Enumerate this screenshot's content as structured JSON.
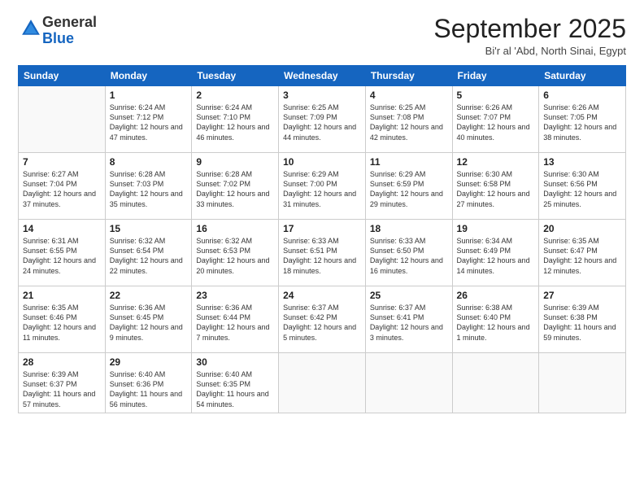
{
  "logo": {
    "general": "General",
    "blue": "Blue"
  },
  "header": {
    "month": "September 2025",
    "location": "Bi'r al 'Abd, North Sinai, Egypt"
  },
  "days_of_week": [
    "Sunday",
    "Monday",
    "Tuesday",
    "Wednesday",
    "Thursday",
    "Friday",
    "Saturday"
  ],
  "weeks": [
    [
      {
        "day": "",
        "empty": true
      },
      {
        "day": "1",
        "sunrise": "Sunrise: 6:24 AM",
        "sunset": "Sunset: 7:12 PM",
        "daylight": "Daylight: 12 hours and 47 minutes."
      },
      {
        "day": "2",
        "sunrise": "Sunrise: 6:24 AM",
        "sunset": "Sunset: 7:10 PM",
        "daylight": "Daylight: 12 hours and 46 minutes."
      },
      {
        "day": "3",
        "sunrise": "Sunrise: 6:25 AM",
        "sunset": "Sunset: 7:09 PM",
        "daylight": "Daylight: 12 hours and 44 minutes."
      },
      {
        "day": "4",
        "sunrise": "Sunrise: 6:25 AM",
        "sunset": "Sunset: 7:08 PM",
        "daylight": "Daylight: 12 hours and 42 minutes."
      },
      {
        "day": "5",
        "sunrise": "Sunrise: 6:26 AM",
        "sunset": "Sunset: 7:07 PM",
        "daylight": "Daylight: 12 hours and 40 minutes."
      },
      {
        "day": "6",
        "sunrise": "Sunrise: 6:26 AM",
        "sunset": "Sunset: 7:05 PM",
        "daylight": "Daylight: 12 hours and 38 minutes."
      }
    ],
    [
      {
        "day": "7",
        "sunrise": "Sunrise: 6:27 AM",
        "sunset": "Sunset: 7:04 PM",
        "daylight": "Daylight: 12 hours and 37 minutes."
      },
      {
        "day": "8",
        "sunrise": "Sunrise: 6:28 AM",
        "sunset": "Sunset: 7:03 PM",
        "daylight": "Daylight: 12 hours and 35 minutes."
      },
      {
        "day": "9",
        "sunrise": "Sunrise: 6:28 AM",
        "sunset": "Sunset: 7:02 PM",
        "daylight": "Daylight: 12 hours and 33 minutes."
      },
      {
        "day": "10",
        "sunrise": "Sunrise: 6:29 AM",
        "sunset": "Sunset: 7:00 PM",
        "daylight": "Daylight: 12 hours and 31 minutes."
      },
      {
        "day": "11",
        "sunrise": "Sunrise: 6:29 AM",
        "sunset": "Sunset: 6:59 PM",
        "daylight": "Daylight: 12 hours and 29 minutes."
      },
      {
        "day": "12",
        "sunrise": "Sunrise: 6:30 AM",
        "sunset": "Sunset: 6:58 PM",
        "daylight": "Daylight: 12 hours and 27 minutes."
      },
      {
        "day": "13",
        "sunrise": "Sunrise: 6:30 AM",
        "sunset": "Sunset: 6:56 PM",
        "daylight": "Daylight: 12 hours and 25 minutes."
      }
    ],
    [
      {
        "day": "14",
        "sunrise": "Sunrise: 6:31 AM",
        "sunset": "Sunset: 6:55 PM",
        "daylight": "Daylight: 12 hours and 24 minutes."
      },
      {
        "day": "15",
        "sunrise": "Sunrise: 6:32 AM",
        "sunset": "Sunset: 6:54 PM",
        "daylight": "Daylight: 12 hours and 22 minutes."
      },
      {
        "day": "16",
        "sunrise": "Sunrise: 6:32 AM",
        "sunset": "Sunset: 6:53 PM",
        "daylight": "Daylight: 12 hours and 20 minutes."
      },
      {
        "day": "17",
        "sunrise": "Sunrise: 6:33 AM",
        "sunset": "Sunset: 6:51 PM",
        "daylight": "Daylight: 12 hours and 18 minutes."
      },
      {
        "day": "18",
        "sunrise": "Sunrise: 6:33 AM",
        "sunset": "Sunset: 6:50 PM",
        "daylight": "Daylight: 12 hours and 16 minutes."
      },
      {
        "day": "19",
        "sunrise": "Sunrise: 6:34 AM",
        "sunset": "Sunset: 6:49 PM",
        "daylight": "Daylight: 12 hours and 14 minutes."
      },
      {
        "day": "20",
        "sunrise": "Sunrise: 6:35 AM",
        "sunset": "Sunset: 6:47 PM",
        "daylight": "Daylight: 12 hours and 12 minutes."
      }
    ],
    [
      {
        "day": "21",
        "sunrise": "Sunrise: 6:35 AM",
        "sunset": "Sunset: 6:46 PM",
        "daylight": "Daylight: 12 hours and 11 minutes."
      },
      {
        "day": "22",
        "sunrise": "Sunrise: 6:36 AM",
        "sunset": "Sunset: 6:45 PM",
        "daylight": "Daylight: 12 hours and 9 minutes."
      },
      {
        "day": "23",
        "sunrise": "Sunrise: 6:36 AM",
        "sunset": "Sunset: 6:44 PM",
        "daylight": "Daylight: 12 hours and 7 minutes."
      },
      {
        "day": "24",
        "sunrise": "Sunrise: 6:37 AM",
        "sunset": "Sunset: 6:42 PM",
        "daylight": "Daylight: 12 hours and 5 minutes."
      },
      {
        "day": "25",
        "sunrise": "Sunrise: 6:37 AM",
        "sunset": "Sunset: 6:41 PM",
        "daylight": "Daylight: 12 hours and 3 minutes."
      },
      {
        "day": "26",
        "sunrise": "Sunrise: 6:38 AM",
        "sunset": "Sunset: 6:40 PM",
        "daylight": "Daylight: 12 hours and 1 minute."
      },
      {
        "day": "27",
        "sunrise": "Sunrise: 6:39 AM",
        "sunset": "Sunset: 6:38 PM",
        "daylight": "Daylight: 11 hours and 59 minutes."
      }
    ],
    [
      {
        "day": "28",
        "sunrise": "Sunrise: 6:39 AM",
        "sunset": "Sunset: 6:37 PM",
        "daylight": "Daylight: 11 hours and 57 minutes."
      },
      {
        "day": "29",
        "sunrise": "Sunrise: 6:40 AM",
        "sunset": "Sunset: 6:36 PM",
        "daylight": "Daylight: 11 hours and 56 minutes."
      },
      {
        "day": "30",
        "sunrise": "Sunrise: 6:40 AM",
        "sunset": "Sunset: 6:35 PM",
        "daylight": "Daylight: 11 hours and 54 minutes."
      },
      {
        "day": "",
        "empty": true
      },
      {
        "day": "",
        "empty": true
      },
      {
        "day": "",
        "empty": true
      },
      {
        "day": "",
        "empty": true
      }
    ]
  ]
}
